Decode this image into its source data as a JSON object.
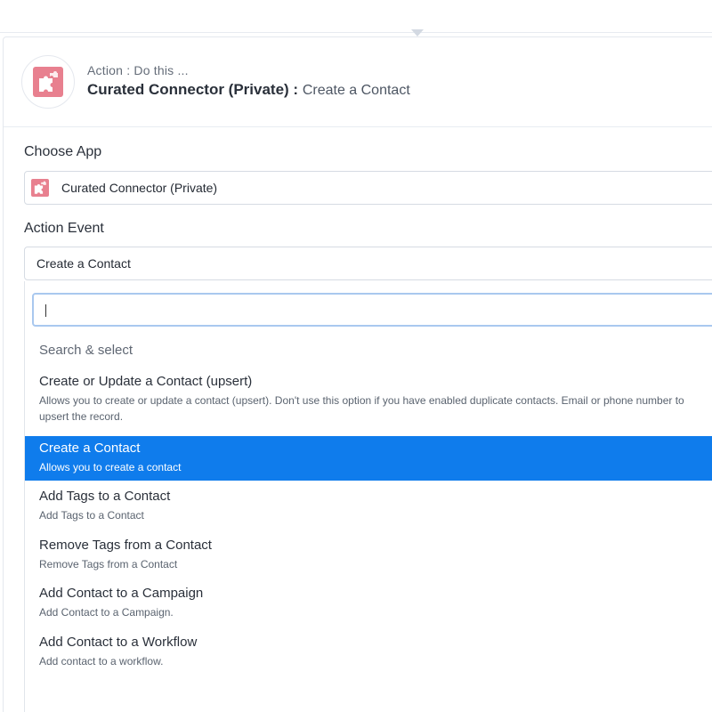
{
  "header": {
    "subtitle": "Action : Do this ...",
    "app_name": "Curated Connector (Private)",
    "separator": " : ",
    "action_name": "Create a Contact"
  },
  "choose_app": {
    "label": "Choose App",
    "value": "Curated Connector (Private)",
    "icon": "puzzle-icon"
  },
  "action_event": {
    "label": "Action Event",
    "value": "Create a Contact"
  },
  "dropdown": {
    "search_value": "",
    "hint": "Search & select",
    "options": [
      {
        "title": "Create or Update a Contact (upsert)",
        "desc": "Allows you to create or update a contact (upsert). Don't use this option if you have enabled duplicate contacts. Email or phone number to upsert the record."
      },
      {
        "title": "Create a Contact",
        "desc": "Allows you to create a contact"
      },
      {
        "title": "Add Tags to a Contact",
        "desc": "Add Tags to a Contact"
      },
      {
        "title": "Remove Tags from a Contact",
        "desc": "Remove Tags from a Contact"
      },
      {
        "title": "Add Contact to a Campaign",
        "desc": "Add Contact to a Campaign."
      },
      {
        "title": "Add Contact to a Workflow",
        "desc": "Add contact to a workflow."
      }
    ]
  },
  "colors": {
    "selected_bg": "#0f7cec",
    "logo_bg": "#e8808f"
  }
}
